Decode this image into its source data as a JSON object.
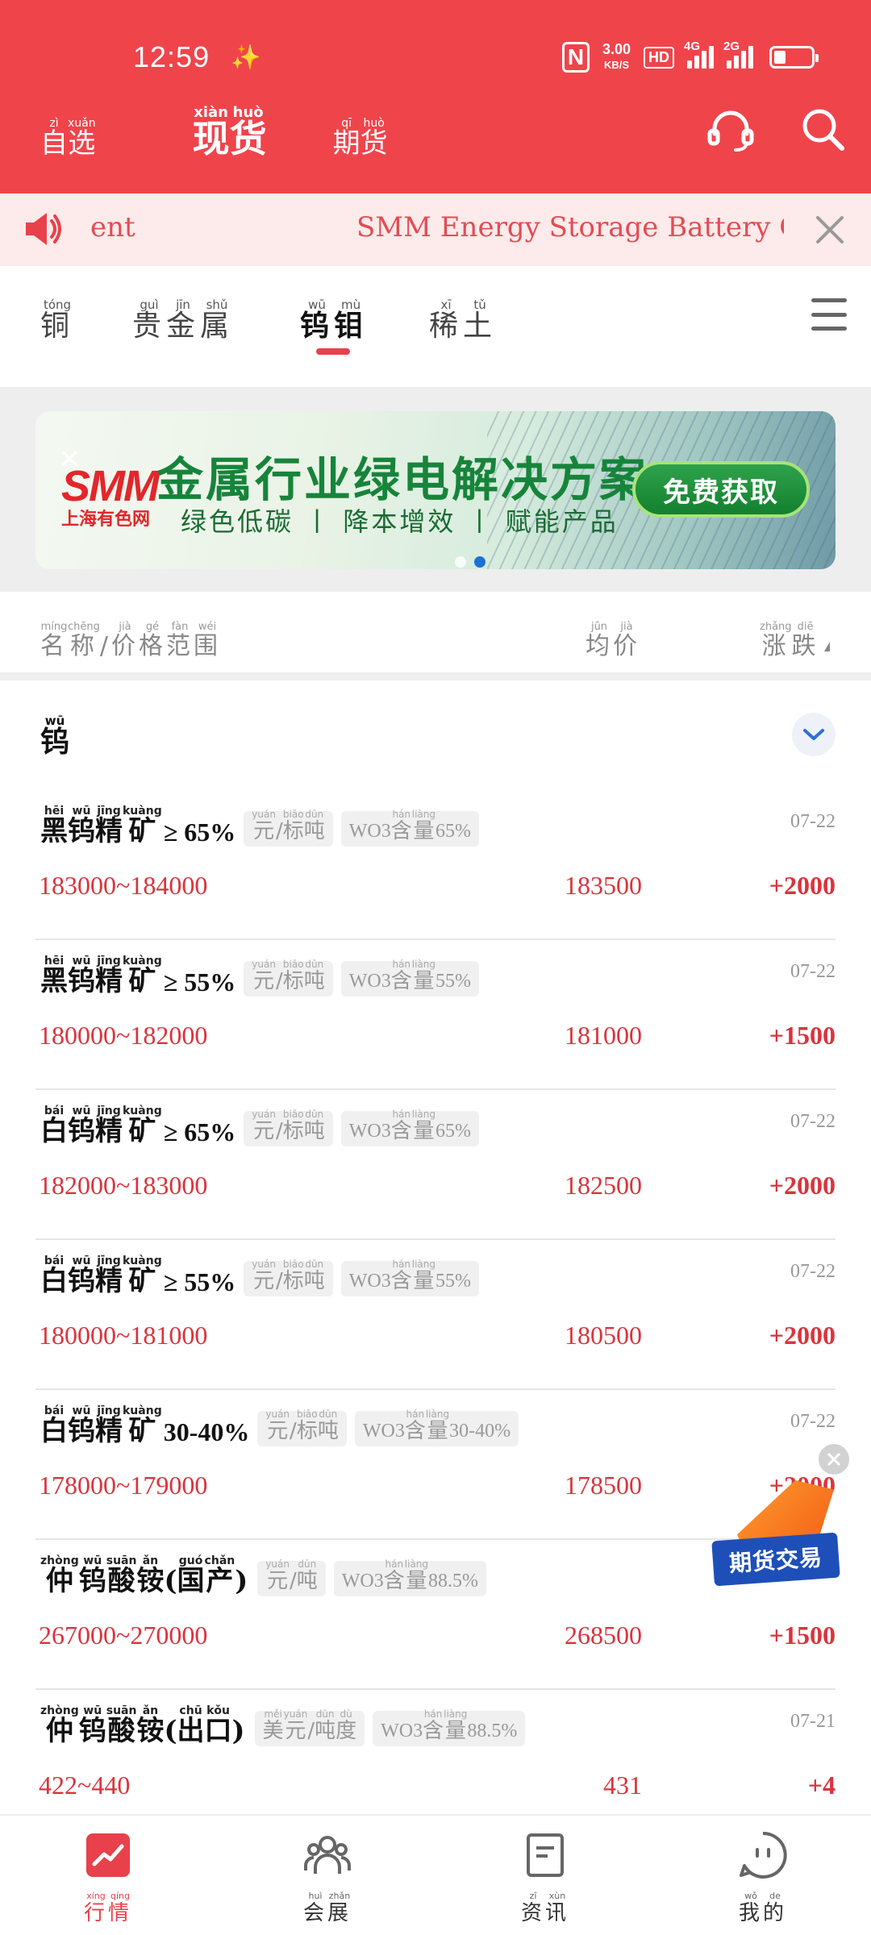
{
  "status_bar": {
    "time": "12:59",
    "net_speed_value": "3.00",
    "net_speed_unit": "KB/S",
    "hd_label": "HD",
    "sim1": "4G",
    "sim2": "2G"
  },
  "top_tabs": [
    {
      "chars": [
        {
          "hz": "自",
          "py": "zì"
        },
        {
          "hz": "选",
          "py": "xuǎn"
        }
      ]
    },
    {
      "chars": [
        {
          "hz": "现",
          "py": "xiàn"
        },
        {
          "hz": "货",
          "py": "huò"
        }
      ]
    },
    {
      "chars": [
        {
          "hz": "期",
          "py": "qī"
        },
        {
          "hz": "货",
          "py": "huò"
        }
      ]
    }
  ],
  "ticker": {
    "left_fragment": "ent",
    "text": "SMM Energy Storage Battery Ce"
  },
  "categories": [
    {
      "chars": [
        {
          "hz": "铜",
          "py": "tóng"
        }
      ]
    },
    {
      "chars": [
        {
          "hz": "贵",
          "py": "guì"
        },
        {
          "hz": "金",
          "py": "jīn"
        },
        {
          "hz": "属",
          "py": "shǔ"
        }
      ]
    },
    {
      "chars": [
        {
          "hz": "钨",
          "py": "wū"
        },
        {
          "hz": "钼",
          "py": "mù"
        }
      ]
    },
    {
      "chars": [
        {
          "hz": "稀",
          "py": "xī"
        },
        {
          "hz": "土",
          "py": "tǔ"
        }
      ]
    }
  ],
  "banner": {
    "logo": "SMM",
    "logo_sub": "上海有色网",
    "title": "金属行业绿电解决方案",
    "subtitle": "绿色低碳 丨 降本增效 丨 赋能产品",
    "button": "免费获取"
  },
  "list_header": {
    "name_col": {
      "chars": [
        {
          "hz": "名",
          "py": "míng"
        },
        {
          "hz": "称",
          "py": "chēng"
        },
        {
          "hz": "/",
          "py": ""
        },
        {
          "hz": "价",
          "py": "jià"
        },
        {
          "hz": "格",
          "py": "gé"
        },
        {
          "hz": "范",
          "py": "fàn"
        },
        {
          "hz": "围",
          "py": "wéi"
        }
      ]
    },
    "avg_col": {
      "chars": [
        {
          "hz": "均",
          "py": "jūn"
        },
        {
          "hz": "价",
          "py": "jià"
        }
      ]
    },
    "chg_col": {
      "chars": [
        {
          "hz": "涨",
          "py": "zhǎng"
        },
        {
          "hz": "跌",
          "py": "diē"
        }
      ]
    }
  },
  "section": {
    "chars": [
      {
        "hz": "钨",
        "py": "wū"
      }
    ]
  },
  "rows": [
    {
      "name": [
        {
          "hz": "黑",
          "py": "hēi"
        },
        {
          "hz": "钨",
          "py": "wū"
        },
        {
          "hz": "精",
          "py": "jīng"
        },
        {
          "hz": "矿",
          "py": "kuàng"
        }
      ],
      "tail": " ≥ 65%",
      "unit": [
        {
          "hz": "元",
          "py": "yuán"
        },
        {
          "hz": "/",
          "py": ""
        },
        {
          "hz": "标",
          "py": "biāo"
        },
        {
          "hz": "吨",
          "py": "dūn"
        }
      ],
      "spec_prefix": "WO3",
      "spec": [
        {
          "hz": "含",
          "py": "hán"
        },
        {
          "hz": "量",
          "py": "liàng"
        }
      ],
      "spec_suffix": "65%",
      "date": "07-22",
      "range": "183000~184000",
      "avg": "183500",
      "change": "+2000"
    },
    {
      "name": [
        {
          "hz": "黑",
          "py": "hēi"
        },
        {
          "hz": "钨",
          "py": "wū"
        },
        {
          "hz": "精",
          "py": "jīng"
        },
        {
          "hz": "矿",
          "py": "kuàng"
        }
      ],
      "tail": " ≥ 55%",
      "unit": [
        {
          "hz": "元",
          "py": "yuán"
        },
        {
          "hz": "/",
          "py": ""
        },
        {
          "hz": "标",
          "py": "biāo"
        },
        {
          "hz": "吨",
          "py": "dūn"
        }
      ],
      "spec_prefix": "WO3",
      "spec": [
        {
          "hz": "含",
          "py": "hán"
        },
        {
          "hz": "量",
          "py": "liàng"
        }
      ],
      "spec_suffix": "55%",
      "date": "07-22",
      "range": "180000~182000",
      "avg": "181000",
      "change": "+1500"
    },
    {
      "name": [
        {
          "hz": "白",
          "py": "bái"
        },
        {
          "hz": "钨",
          "py": "wū"
        },
        {
          "hz": "精",
          "py": "jīng"
        },
        {
          "hz": "矿",
          "py": "kuàng"
        }
      ],
      "tail": " ≥ 65%",
      "unit": [
        {
          "hz": "元",
          "py": "yuán"
        },
        {
          "hz": "/",
          "py": ""
        },
        {
          "hz": "标",
          "py": "biāo"
        },
        {
          "hz": "吨",
          "py": "dūn"
        }
      ],
      "spec_prefix": "WO3",
      "spec": [
        {
          "hz": "含",
          "py": "hán"
        },
        {
          "hz": "量",
          "py": "liàng"
        }
      ],
      "spec_suffix": "65%",
      "date": "07-22",
      "range": "182000~183000",
      "avg": "182500",
      "change": "+2000"
    },
    {
      "name": [
        {
          "hz": "白",
          "py": "bái"
        },
        {
          "hz": "钨",
          "py": "wū"
        },
        {
          "hz": "精",
          "py": "jīng"
        },
        {
          "hz": "矿",
          "py": "kuàng"
        }
      ],
      "tail": " ≥ 55%",
      "unit": [
        {
          "hz": "元",
          "py": "yuán"
        },
        {
          "hz": "/",
          "py": ""
        },
        {
          "hz": "标",
          "py": "biāo"
        },
        {
          "hz": "吨",
          "py": "dūn"
        }
      ],
      "spec_prefix": "WO3",
      "spec": [
        {
          "hz": "含",
          "py": "hán"
        },
        {
          "hz": "量",
          "py": "liàng"
        }
      ],
      "spec_suffix": "55%",
      "date": "07-22",
      "range": "180000~181000",
      "avg": "180500",
      "change": "+2000"
    },
    {
      "name": [
        {
          "hz": "白",
          "py": "bái"
        },
        {
          "hz": "钨",
          "py": "wū"
        },
        {
          "hz": "精",
          "py": "jīng"
        },
        {
          "hz": "矿",
          "py": "kuàng"
        }
      ],
      "tail": "30-40%",
      "unit": [
        {
          "hz": "元",
          "py": "yuán"
        },
        {
          "hz": "/",
          "py": ""
        },
        {
          "hz": "标",
          "py": "biāo"
        },
        {
          "hz": "吨",
          "py": "dūn"
        }
      ],
      "spec_prefix": "WO3",
      "spec": [
        {
          "hz": "含",
          "py": "hán"
        },
        {
          "hz": "量",
          "py": "liàng"
        }
      ],
      "spec_suffix": "30-40%",
      "date": "07-22",
      "range": "178000~179000",
      "avg": "178500",
      "change": "+2000"
    },
    {
      "name": [
        {
          "hz": "仲",
          "py": "zhòng"
        },
        {
          "hz": "钨",
          "py": "wū"
        },
        {
          "hz": "酸",
          "py": "suān"
        },
        {
          "hz": "铵",
          "py": "ǎn"
        },
        {
          "hz": "(",
          "py": ""
        },
        {
          "hz": "国",
          "py": "guó"
        },
        {
          "hz": "产",
          "py": "chǎn"
        },
        {
          "hz": ")",
          "py": ""
        }
      ],
      "tail": "",
      "unit": [
        {
          "hz": "元",
          "py": "yuán"
        },
        {
          "hz": "/",
          "py": ""
        },
        {
          "hz": "吨",
          "py": "dūn"
        }
      ],
      "spec_prefix": "WO3",
      "spec": [
        {
          "hz": "含",
          "py": "hán"
        },
        {
          "hz": "量",
          "py": "liàng"
        }
      ],
      "spec_suffix": "88.5%",
      "date": "",
      "range": "267000~270000",
      "avg": "268500",
      "change": "+1500"
    },
    {
      "name": [
        {
          "hz": "仲",
          "py": "zhòng"
        },
        {
          "hz": "钨",
          "py": "wū"
        },
        {
          "hz": "酸",
          "py": "suān"
        },
        {
          "hz": "铵",
          "py": "ǎn"
        },
        {
          "hz": "(",
          "py": ""
        },
        {
          "hz": "出",
          "py": "chū"
        },
        {
          "hz": "口",
          "py": "kǒu"
        },
        {
          "hz": ")",
          "py": ""
        }
      ],
      "tail": "",
      "unit": [
        {
          "hz": "美",
          "py": "měi"
        },
        {
          "hz": "元",
          "py": "yuán"
        },
        {
          "hz": "/",
          "py": ""
        },
        {
          "hz": "吨",
          "py": "dūn"
        },
        {
          "hz": "度",
          "py": "dù"
        }
      ],
      "spec_prefix": "WO3",
      "spec": [
        {
          "hz": "含",
          "py": "hán"
        },
        {
          "hz": "量",
          "py": "liàng"
        }
      ],
      "spec_suffix": "88.5%",
      "date": "07-21",
      "range": "422~440",
      "avg": "431",
      "change": "+4"
    }
  ],
  "float_ad": {
    "label": "期货交易"
  },
  "bottom_nav": [
    {
      "chars": [
        {
          "hz": "行",
          "py": "xíng"
        },
        {
          "hz": "情",
          "py": "qíng"
        }
      ]
    },
    {
      "chars": [
        {
          "hz": "会",
          "py": "huì"
        },
        {
          "hz": "展",
          "py": "zhǎn"
        }
      ]
    },
    {
      "chars": [
        {
          "hz": "资",
          "py": "zī"
        },
        {
          "hz": "讯",
          "py": "xùn"
        }
      ]
    },
    {
      "chars": [
        {
          "hz": "我",
          "py": "wǒ"
        },
        {
          "hz": "的",
          "py": "de"
        }
      ]
    }
  ],
  "colors": {
    "brand_red": "#f0444b",
    "price_red": "#d9343d",
    "active_blue": "#1b72d6",
    "banner_green": "#16843a"
  },
  "icons": [
    "signal-icon",
    "headset-icon",
    "search-icon",
    "speaker-icon",
    "close-icon",
    "menu-icon",
    "chevron-down-icon",
    "market-icon",
    "people-icon",
    "news-icon",
    "profile-icon"
  ]
}
